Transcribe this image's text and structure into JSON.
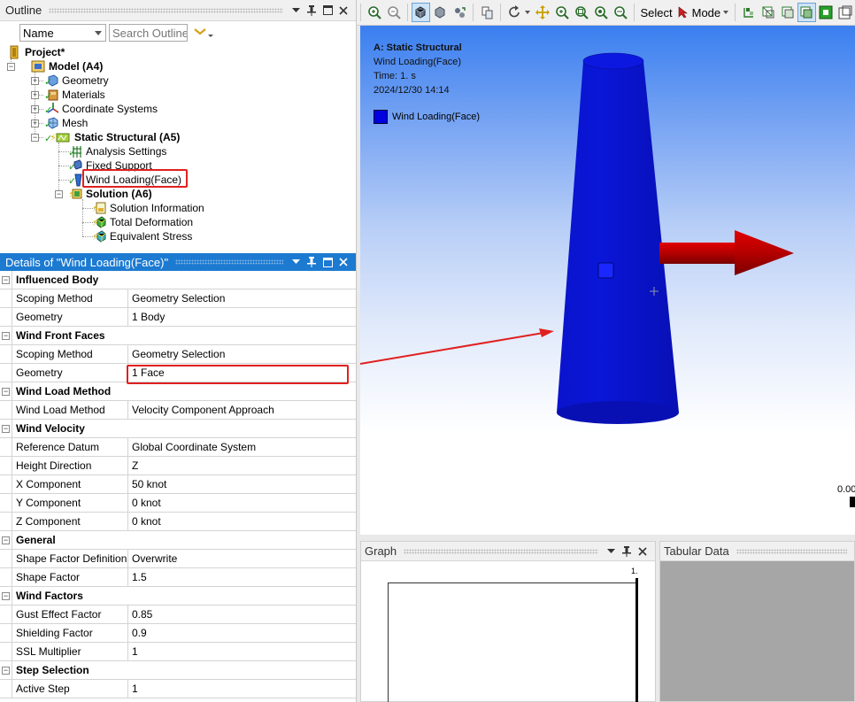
{
  "outline": {
    "title": "Outline",
    "name_filter": "Name",
    "search_placeholder": "Search Outline",
    "tree": [
      {
        "label": "Project*",
        "bold": true
      },
      {
        "label": "Model (A4)",
        "bold": true
      },
      {
        "label": "Geometry",
        "bold": false
      },
      {
        "label": "Materials",
        "bold": false
      },
      {
        "label": "Coordinate Systems",
        "bold": false
      },
      {
        "label": "Mesh",
        "bold": false
      },
      {
        "label": "Static Structural (A5)",
        "bold": true
      },
      {
        "label": "Analysis Settings",
        "bold": false
      },
      {
        "label": "Fixed Support",
        "bold": false
      },
      {
        "label": "Wind Loading(Face)",
        "bold": false
      },
      {
        "label": "Solution (A6)",
        "bold": true
      },
      {
        "label": "Solution Information",
        "bold": false
      },
      {
        "label": "Total Deformation",
        "bold": false
      },
      {
        "label": "Equivalent Stress",
        "bold": false
      }
    ]
  },
  "details": {
    "title": "Details of \"Wind Loading(Face)\"",
    "groups": [
      {
        "name": "Influenced Body",
        "rows": [
          {
            "name": "Scoping Method",
            "value": "Geometry Selection"
          },
          {
            "name": "Geometry",
            "value": "1 Body"
          }
        ]
      },
      {
        "name": "Wind Front Faces",
        "rows": [
          {
            "name": "Scoping Method",
            "value": "Geometry Selection"
          },
          {
            "name": "Geometry",
            "value": "1 Face"
          }
        ]
      },
      {
        "name": "Wind Load Method",
        "rows": [
          {
            "name": "Wind Load Method",
            "value": "Velocity Component Approach"
          }
        ]
      },
      {
        "name": "Wind Velocity",
        "rows": [
          {
            "name": "Reference Datum",
            "value": "Global Coordinate System"
          },
          {
            "name": "Height Direction",
            "value": "Z"
          },
          {
            "name": "X Component",
            "value": "50 knot"
          },
          {
            "name": "Y Component",
            "value": "0 knot"
          },
          {
            "name": "Z Component",
            "value": "0 knot"
          }
        ]
      },
      {
        "name": "General",
        "rows": [
          {
            "name": "Shape Factor Definition",
            "value": "Overwrite"
          },
          {
            "name": "Shape Factor",
            "value": "1.5"
          }
        ]
      },
      {
        "name": "Wind Factors",
        "rows": [
          {
            "name": "Gust Effect Factor",
            "value": "0.85"
          },
          {
            "name": "Shielding Factor",
            "value": "0.9"
          },
          {
            "name": "SSL Multiplier",
            "value": "1"
          }
        ]
      },
      {
        "name": "Step Selection",
        "rows": [
          {
            "name": "Active Step",
            "value": "1"
          }
        ]
      }
    ]
  },
  "toolbar": {
    "select_label": "Select",
    "mode_label": "Mode"
  },
  "viewport": {
    "analysis_title": "A: Static Structural",
    "load_name": "Wind Loading(Face)",
    "time": "Time: 1. s",
    "date": "2024/12/30 14:14",
    "legend_label": "Wind Loading(Face)",
    "scale_value": "0.00",
    "body_color": "#0a14d2",
    "arrow_color": "#c80000"
  },
  "graph": {
    "title": "Graph",
    "axis_label": "1."
  },
  "tabular": {
    "title": "Tabular Data"
  },
  "colors": {
    "accent": "#1c7ad1",
    "highlight": "#e02020"
  }
}
